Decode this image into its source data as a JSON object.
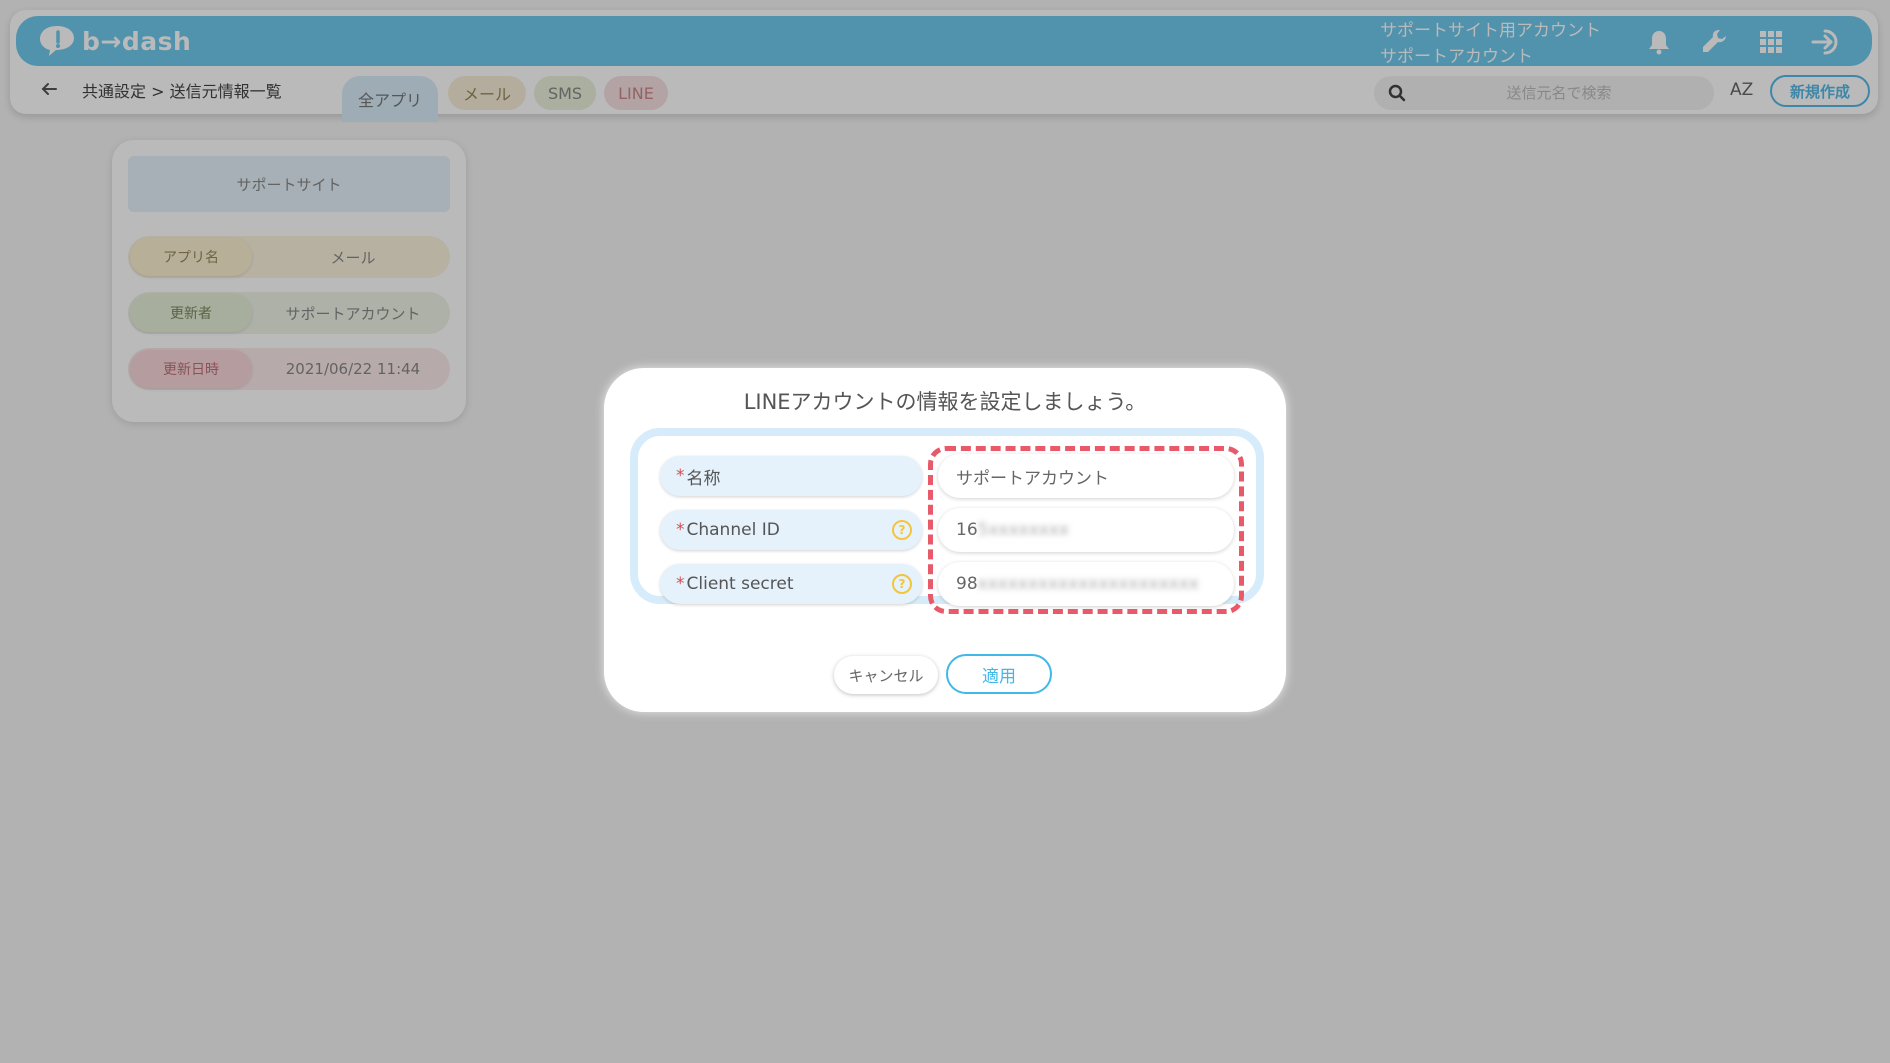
{
  "header": {
    "logo_text": "b→dash",
    "account_line1": "サポートサイト用アカウント",
    "account_line2": "サポートアカウント",
    "icons": [
      "bell-icon",
      "wrench-icon",
      "grid-icon",
      "logout-icon"
    ]
  },
  "subbar": {
    "breadcrumb": "共通設定  >  送信元情報一覧",
    "tabs": [
      {
        "label": "全アプリ"
      },
      {
        "label": "メール"
      },
      {
        "label": "SMS"
      },
      {
        "label": "LINE"
      }
    ],
    "search_placeholder": "送信元名で検索",
    "sort_label": "AZ",
    "new_button": "新規作成"
  },
  "card": {
    "title": "サポートサイト",
    "rows": [
      {
        "label": "アプリ名",
        "value": "メール"
      },
      {
        "label": "更新者",
        "value": "サポートアカウント"
      },
      {
        "label": "更新日時",
        "value": "2021/06/22 11:44"
      }
    ]
  },
  "modal": {
    "title": "LINEアカウントの情報を設定しましょう。",
    "required_mark": "*",
    "fields": [
      {
        "label": "名称",
        "value": "サポートアカウント"
      },
      {
        "label": "Channel ID",
        "value_visible": "16",
        "value_blurred": "5xxxxxxxx"
      },
      {
        "label": "Client secret",
        "value_visible": "98",
        "value_blurred": "xxxxxxxxxxxxxxxxxxxxxx"
      }
    ],
    "help_glyph": "?",
    "cancel_label": "キャンセル",
    "apply_label": "適用"
  },
  "colors": {
    "brand": "#6fc8ec",
    "accent": "#3fb8ea",
    "highlight": "#e85a6a",
    "help": "#f2c53d"
  }
}
